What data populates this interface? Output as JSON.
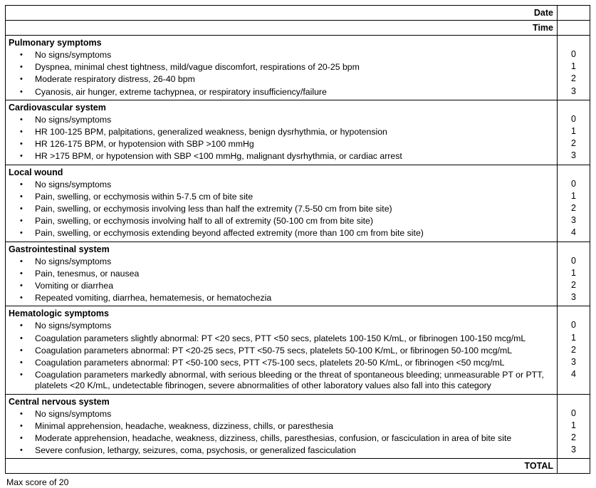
{
  "header": {
    "date_label": "Date",
    "time_label": "Time",
    "date_value": "",
    "time_value": ""
  },
  "bullet_glyph": "•",
  "sections": [
    {
      "title": "Pulmonary symptoms",
      "items": [
        {
          "text": "No signs/symptoms",
          "score": "0"
        },
        {
          "text": "Dyspnea, minimal chest tightness, mild/vague discomfort, respirations of 20-25 bpm",
          "score": "1"
        },
        {
          "text": "Moderate respiratory distress, 26-40 bpm",
          "score": "2"
        },
        {
          "text": "Cyanosis, air hunger, extreme tachypnea, or respiratory insufficiency/failure",
          "score": "3"
        }
      ]
    },
    {
      "title": "Cardiovascular system",
      "items": [
        {
          "text": "No signs/symptoms",
          "score": "0"
        },
        {
          "text": "HR 100-125 BPM, palpitations, generalized weakness, benign dysrhythmia, or hypotension",
          "score": "1"
        },
        {
          "text": "HR 126-175 BPM, or hypotension with SBP >100 mmHg",
          "score": "2"
        },
        {
          "text": "HR >175 BPM, or hypotension with SBP <100 mmHg, malignant dysrhythmia, or cardiac arrest",
          "score": "3"
        }
      ]
    },
    {
      "title": "Local wound",
      "items": [
        {
          "text": "No signs/symptoms",
          "score": "0"
        },
        {
          "text": "Pain, swelling, or ecchymosis within 5-7.5 cm of bite site",
          "score": "1"
        },
        {
          "text": "Pain, swelling, or ecchymosis involving less than half the extremity (7.5-50 cm from bite site)",
          "score": "2"
        },
        {
          "text": "Pain, swelling, or ecchymosis involving half to all of extremity (50-100 cm from bite site)",
          "score": "3"
        },
        {
          "text": "Pain, swelling, or ecchymosis extending beyond affected extremity (more than 100 cm from bite site)",
          "score": "4"
        }
      ]
    },
    {
      "title": "Gastrointestinal system",
      "items": [
        {
          "text": "No signs/symptoms",
          "score": "0"
        },
        {
          "text": "Pain, tenesmus, or nausea",
          "score": "1"
        },
        {
          "text": "Vomiting or diarrhea",
          "score": "2"
        },
        {
          "text": "Repeated vomiting, diarrhea, hematemesis, or hematochezia",
          "score": "3"
        }
      ]
    },
    {
      "title": "Hematologic symptoms",
      "items": [
        {
          "text": "No signs/symptoms",
          "score": "0"
        },
        {
          "text": "Coagulation parameters slightly abnormal: PT <20 secs, PTT <50 secs, platelets 100-150 K/mL, or fibrinogen 100-150 mcg/mL",
          "score": "1"
        },
        {
          "text": "Coagulation parameters abnormal: PT <20-25 secs, PTT <50-75 secs, platelets 50-100 K/mL, or fibrinogen 50-100 mcg/mL",
          "score": "2"
        },
        {
          "text": "Coagulation parameters abnormal: PT <50-100 secs, PTT <75-100 secs, platelets 20-50 K/mL, or fibrinogen <50 mcg/mL",
          "score": "3"
        },
        {
          "text": "Coagulation parameters markedly abnormal, with serious bleeding or the threat of spontaneous bleeding; unmeasurable PT or PTT, platelets <20 K/mL, undetectable fibrinogen, severe abnormalities of other laboratory values also fall into this category",
          "score": "4"
        }
      ]
    },
    {
      "title": "Central nervous system",
      "items": [
        {
          "text": "No signs/symptoms",
          "score": "0"
        },
        {
          "text": "Minimal apprehension, headache, weakness, dizziness, chills, or paresthesia",
          "score": "1"
        },
        {
          "text": "Moderate apprehension, headache, weakness, dizziness, chills, paresthesias, confusion, or fasciculation in area of bite site",
          "score": "2"
        },
        {
          "text": "Severe confusion, lethargy, seizures, coma, psychosis, or generalized fasciculation",
          "score": "3"
        }
      ]
    }
  ],
  "total": {
    "label": "TOTAL",
    "value": ""
  },
  "footnote": "Max score of 20"
}
